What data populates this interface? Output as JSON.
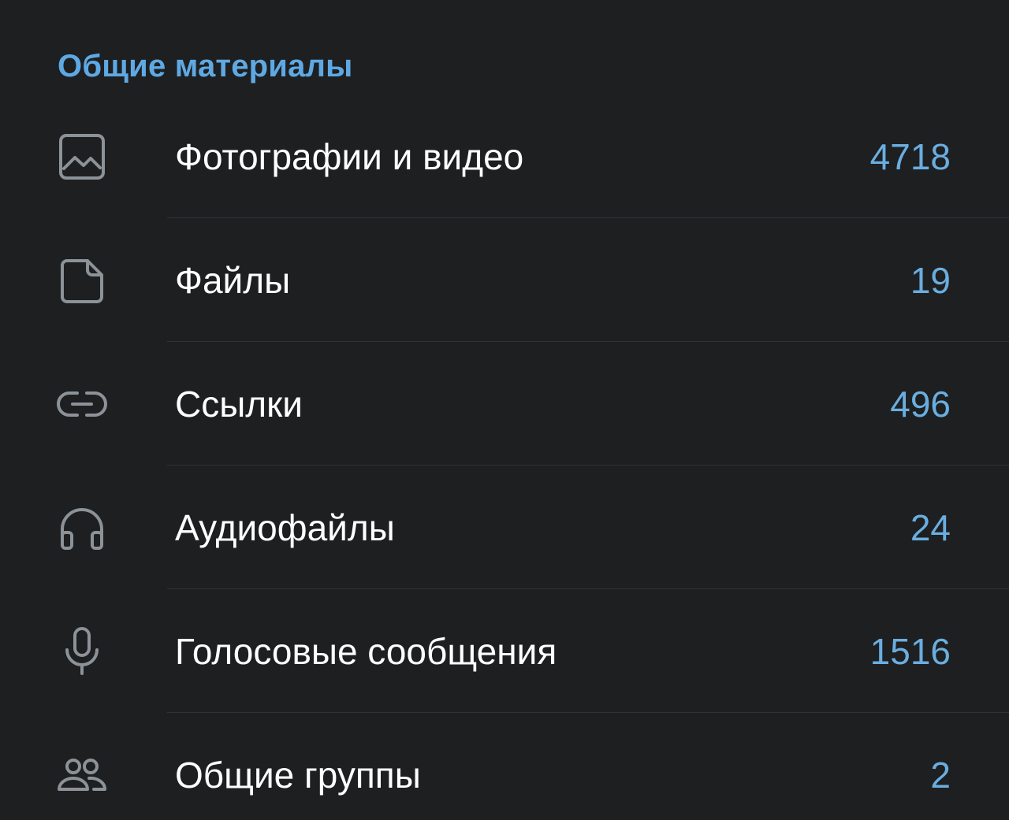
{
  "section": {
    "title": "Общие материалы"
  },
  "items": [
    {
      "label": "Фотографии и видео",
      "count": "4718",
      "icon": "image-icon"
    },
    {
      "label": "Файлы",
      "count": "19",
      "icon": "file-icon"
    },
    {
      "label": "Ссылки",
      "count": "496",
      "icon": "link-icon"
    },
    {
      "label": "Аудиофайлы",
      "count": "24",
      "icon": "headphones-icon"
    },
    {
      "label": "Голосовые сообщения",
      "count": "1516",
      "icon": "microphone-icon"
    },
    {
      "label": "Общие группы",
      "count": "2",
      "icon": "group-icon"
    }
  ],
  "colors": {
    "background": "#1e1f21",
    "accent": "#5ea9e3",
    "count": "#6aaee0",
    "icon": "#8b9298",
    "text": "#ffffff",
    "divider": "#303236"
  }
}
